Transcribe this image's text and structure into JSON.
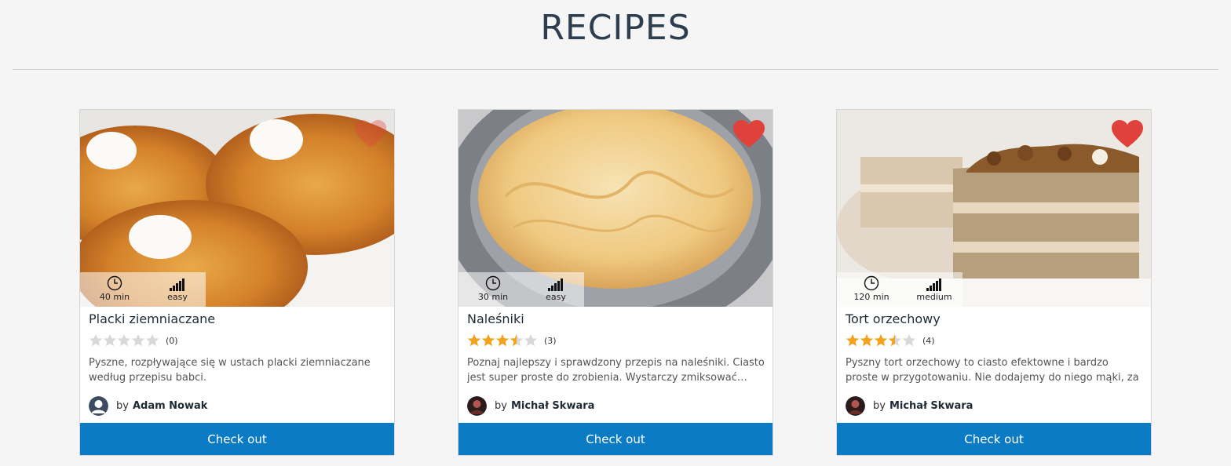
{
  "page": {
    "title": "RECIPES"
  },
  "colors": {
    "accent": "#0a7bc4",
    "heart": "#e0413b",
    "star_filled": "#f2a21d",
    "star_empty": "#d8d8d8"
  },
  "recipes": [
    {
      "title": "Placki ziemniaczane",
      "favorite": false,
      "time": "40 min",
      "difficulty": "easy",
      "rating": 0,
      "rating_count": "(0)",
      "description": "Pyszne, rozpływające się w ustach placki ziemniaczane według przepisu babci.",
      "author_prefix": "by",
      "author": "Adam Nowak",
      "cta": "Check out",
      "image": "potato-pancakes-photo"
    },
    {
      "title": "Naleśniki",
      "favorite": true,
      "time": "30 min",
      "difficulty": "easy",
      "rating": 3.5,
      "rating_count": "(3)",
      "description": "Poznaj najlepszy i sprawdzony przepis na naleśniki. Ciasto jest super proste do zrobienia. Wystarczy zmiksować…",
      "author_prefix": "by",
      "author": "Michał Skwara",
      "cta": "Check out",
      "image": "crepes-photo"
    },
    {
      "title": "Tort orzechowy",
      "favorite": true,
      "time": "120 min",
      "difficulty": "medium",
      "rating": 3.5,
      "rating_count": "(4)",
      "description": "Pyszny tort orzechowy to ciasto efektowne i bardzo proste w przygotowaniu. Nie dodajemy do niego mąki, za to…",
      "author_prefix": "by",
      "author": "Michał Skwara",
      "cta": "Check out",
      "image": "walnut-cake-photo"
    }
  ]
}
